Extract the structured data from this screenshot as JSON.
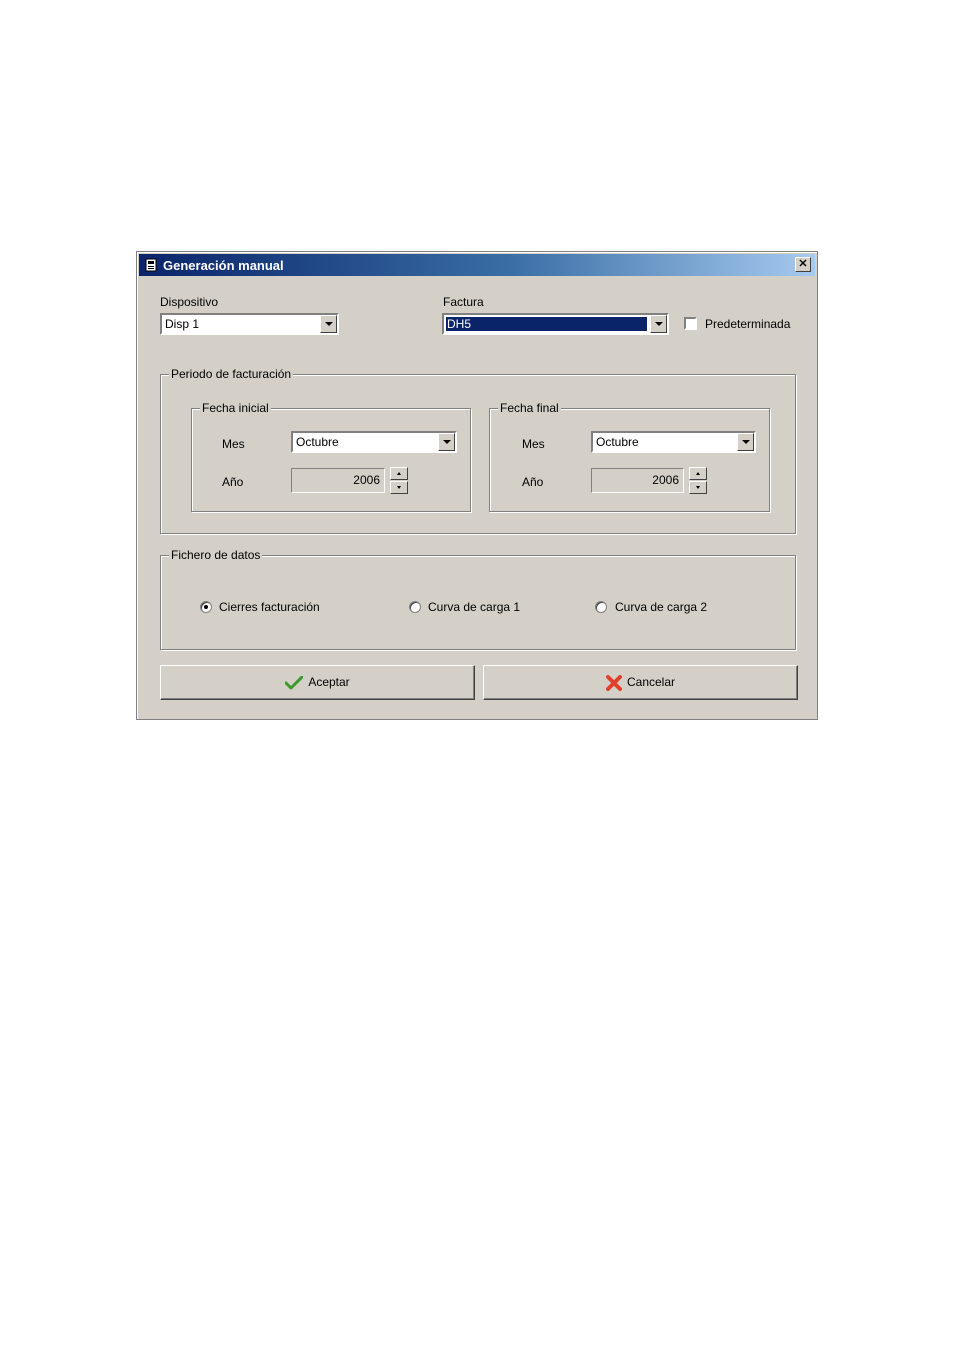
{
  "dialog": {
    "title": "Generación manual",
    "close_glyph": "✕",
    "icon": "app-icon"
  },
  "dispositivo": {
    "label": "Dispositivo",
    "value": "Disp 1"
  },
  "factura": {
    "label": "Factura",
    "value": "DH5"
  },
  "predeterminada": {
    "label": "Predeterminada",
    "checked": false
  },
  "periodo": {
    "legend": "Periodo de facturación",
    "inicial": {
      "legend": "Fecha inicial",
      "mes_label": "Mes",
      "mes_value": "Octubre",
      "anio_label": "Año",
      "anio_value": "2006"
    },
    "final": {
      "legend": "Fecha final",
      "mes_label": "Mes",
      "mes_value": "Octubre",
      "anio_label": "Año",
      "anio_value": "2006"
    }
  },
  "fichero": {
    "legend": "Fichero de datos",
    "options": [
      {
        "label": "Cierres facturación",
        "checked": true
      },
      {
        "label": "Curva de carga 1",
        "checked": false
      },
      {
        "label": "Curva de carga 2",
        "checked": false
      }
    ]
  },
  "buttons": {
    "accept": {
      "label": "Aceptar",
      "icon": "check-icon",
      "color": "#3a9a2a"
    },
    "cancel": {
      "label": "Cancelar",
      "icon": "cross-icon",
      "color": "#e0402a"
    }
  }
}
